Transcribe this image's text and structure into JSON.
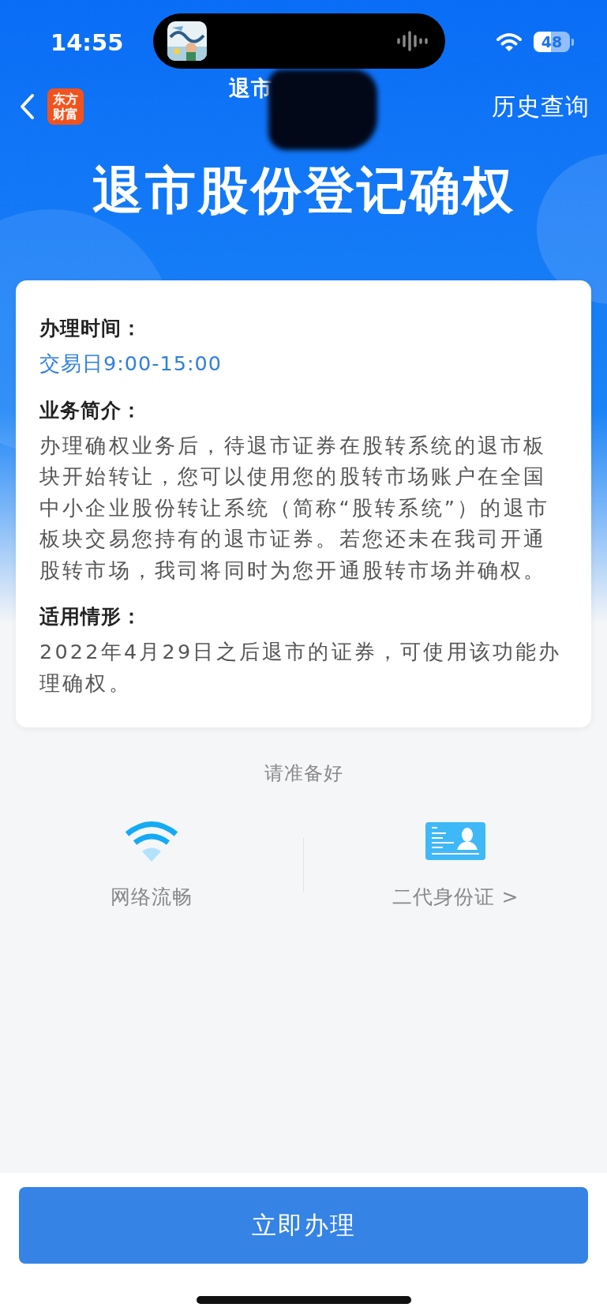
{
  "status_bar": {
    "time": "14:55",
    "battery": "48"
  },
  "nav": {
    "title": "退市",
    "logo_lines": [
      "东方",
      "财富"
    ],
    "history_link": "历史查询"
  },
  "hero_title": "退市股份登记确权",
  "card": {
    "sections": [
      {
        "heading": "办理时间：",
        "body": "交易日9:00-15:00",
        "kind": "highlight"
      },
      {
        "heading": "业务简介：",
        "body": "办理确权业务后，待退市证券在股转系统的退市板块开始转让，您可以使用您的股转市场账户在全国中小企业股份转让系统（简称“股转系统”）的退市板块交易您持有的退市证券。若您还未在我司开通股转市场，我司将同时为您开通股转市场并确权。",
        "kind": "plain"
      },
      {
        "heading": "适用情形：",
        "body": "2022年4月29日之后退市的证券，可使用该功能办理确权。",
        "kind": "plain"
      }
    ]
  },
  "prepare": {
    "title": "请准备好",
    "items": [
      {
        "kind": "wifi",
        "label": "网络流畅"
      },
      {
        "kind": "id-card",
        "label": "二代身份证 >"
      }
    ]
  },
  "primary_button": "立即办理"
}
